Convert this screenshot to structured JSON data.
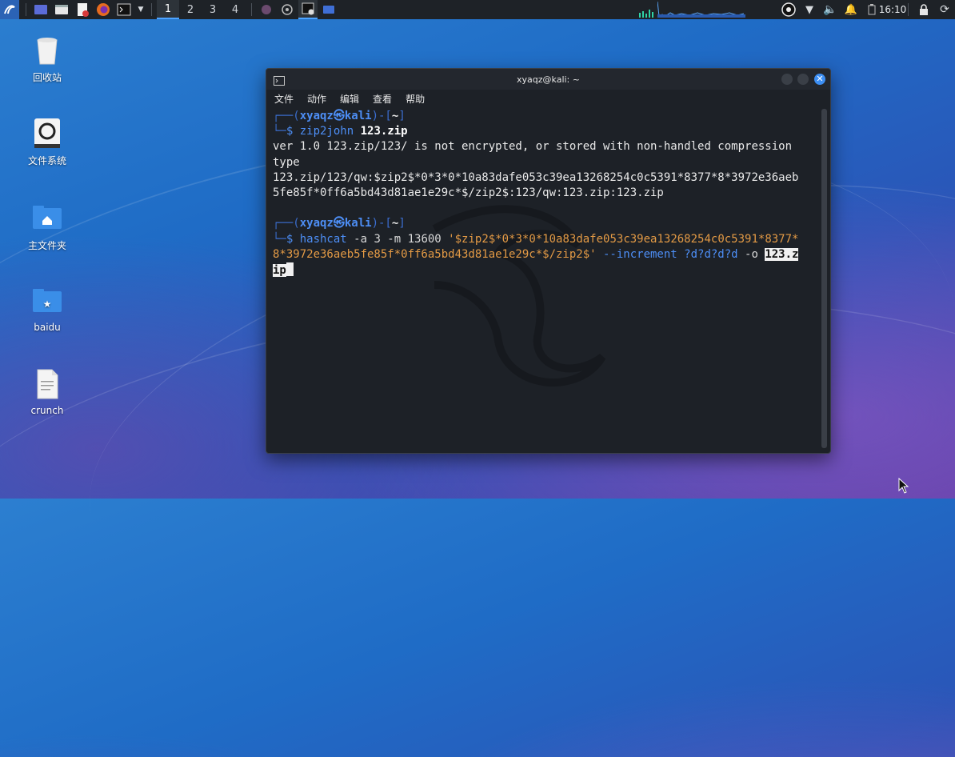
{
  "taskbar": {
    "workspaces": [
      "1",
      "2",
      "3",
      "4"
    ],
    "active_workspace": "1",
    "clock": "16:10"
  },
  "desktop": {
    "icons": [
      {
        "label": "回收站",
        "icon": "trash-icon"
      },
      {
        "label": "文件系统",
        "icon": "drive-icon"
      },
      {
        "label": "主文件夹",
        "icon": "home-folder-icon"
      },
      {
        "label": "baidu",
        "icon": "star-folder-icon"
      },
      {
        "label": "crunch",
        "icon": "text-file-icon"
      }
    ]
  },
  "terminal": {
    "title": "xyaqz@kali: ~",
    "menu": [
      "文件",
      "动作",
      "编辑",
      "查看",
      "帮助"
    ],
    "prompt1": {
      "user": "xyaqz㉿kali",
      "path": "~",
      "cmd": "zip2john",
      "arg": "123.zip"
    },
    "output": [
      "ver 1.0 123.zip/123/ is not encrypted, or stored with non-handled compression",
      "type",
      "123.zip/123/qw:$zip2$*0*3*0*10a83dafe053c39ea13268254c0c5391*8377*8*3972e36aeb",
      "5fe85f*0ff6a5bd43d81ae1e29c*$/zip2$:123/qw:123.zip:123.zip"
    ],
    "prompt2": {
      "user": "xyaqz㉿kali",
      "path": "~",
      "cmd": "hashcat",
      "opts": " -a 3 -m 13600 ",
      "hash_line1": "'$zip2$*0*3*0*10a83dafe053c39ea13268254c0c5391*8377*",
      "hash_line2": "8*3972e36aeb5fe85f*0ff6a5bd43d81ae1e29c*$/zip2$'",
      "increment": " --increment ",
      "mask": "?d?d?d?d",
      "out_flag": " -o ",
      "out_file_1": "123.z",
      "out_file_2": "ip"
    }
  },
  "colors": {
    "accent_blue": "#4d8ef5",
    "string_orange": "#e39a45",
    "terminal_bg": "#1d2127"
  }
}
